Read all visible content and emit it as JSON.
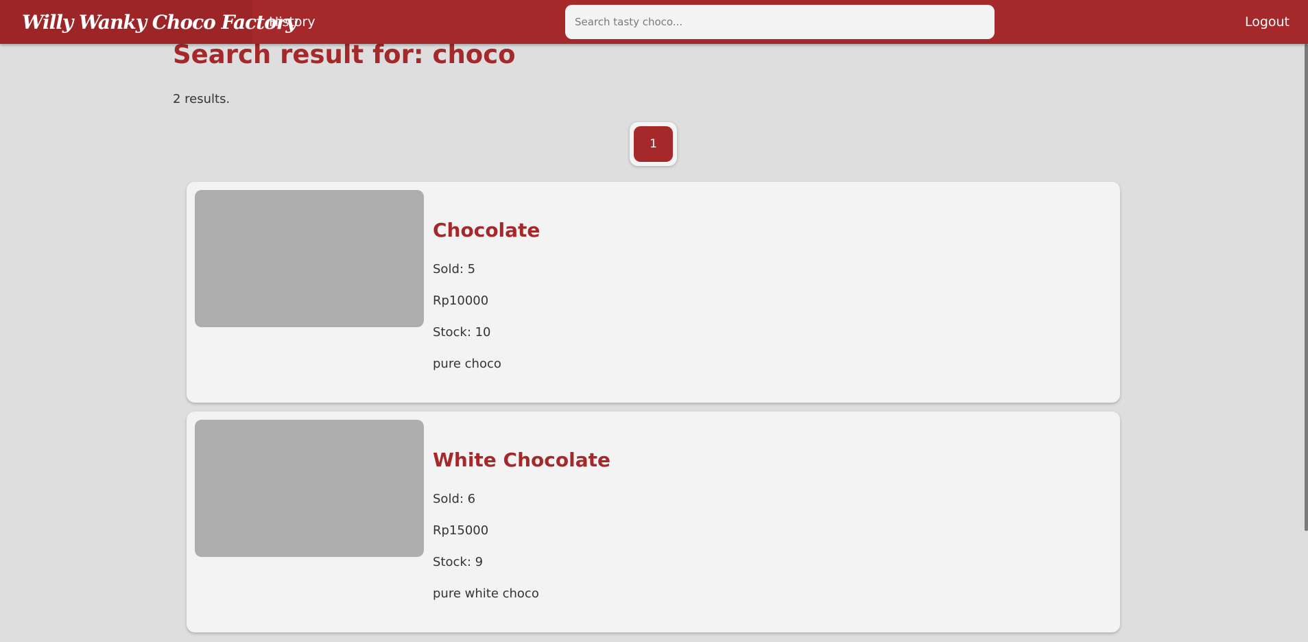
{
  "navbar": {
    "brand": "Willy Wanky Choco Factory",
    "history_label": "History",
    "search_placeholder": "Search tasty choco...",
    "logout_label": "Logout"
  },
  "main": {
    "title": "Search result for: choco",
    "result_count": "2 results.",
    "pagination": {
      "pages": [
        "1"
      ],
      "current_page": "1"
    }
  },
  "products": [
    {
      "name": "Chocolate",
      "sold": "Sold: 5",
      "price": "Rp10000",
      "stock": "Stock: 10",
      "description": "pure choco"
    },
    {
      "name": "White Chocolate",
      "sold": "Sold: 6",
      "price": "Rp15000",
      "stock": "Stock: 9",
      "description": "pure white choco"
    }
  ],
  "colors": {
    "primary": "#a5292a",
    "background": "#dedede",
    "card": "#f3f3f3",
    "image_placeholder": "#adadad"
  }
}
